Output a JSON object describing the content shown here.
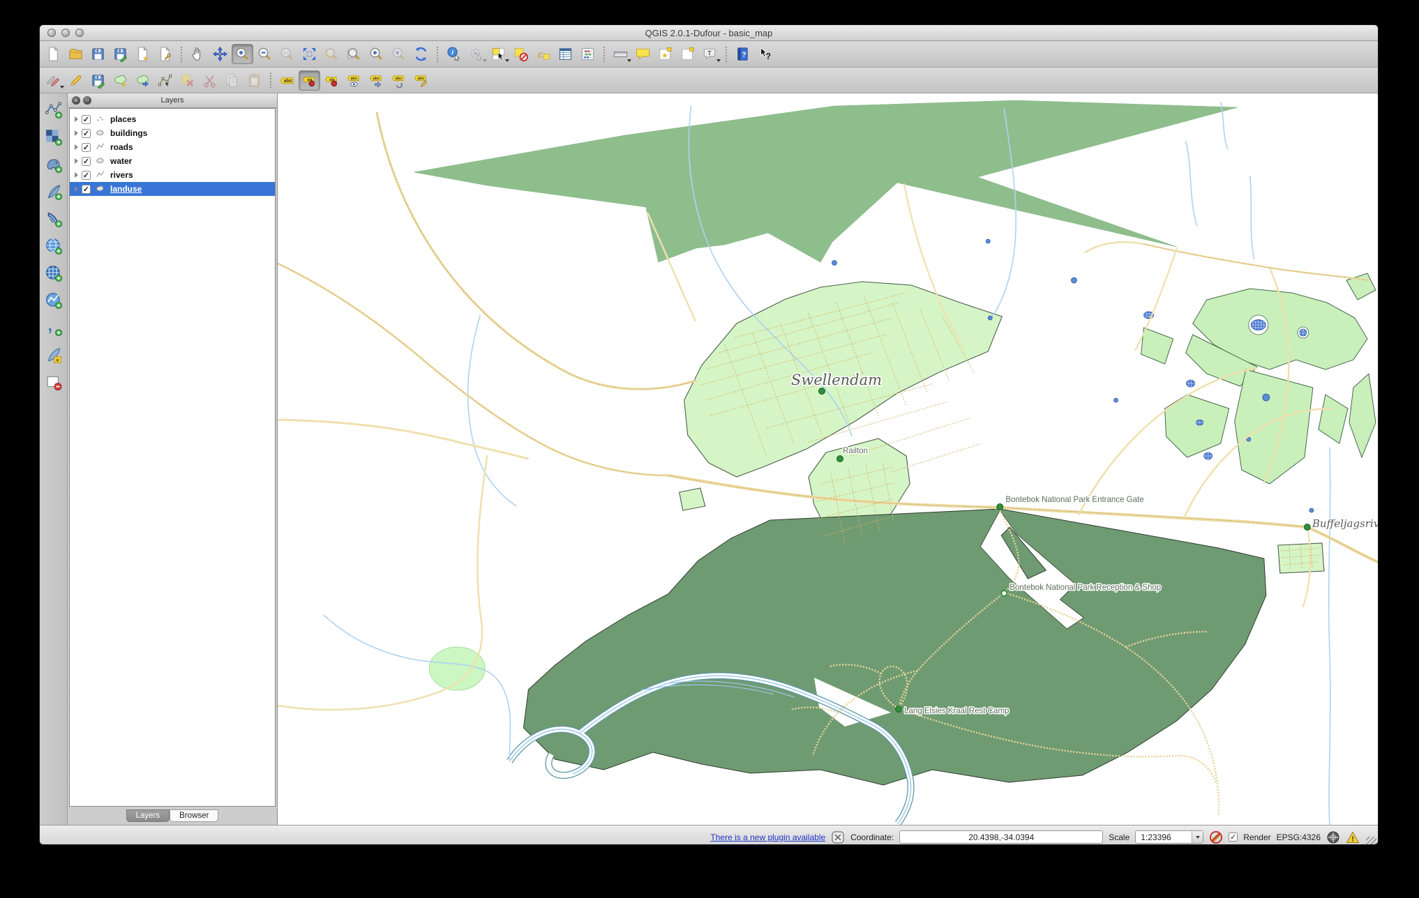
{
  "window": {
    "title": "QGIS 2.0.1-Dufour - basic_map"
  },
  "toolbars": {
    "row1": [
      {
        "name": "new-project",
        "icon": "pg"
      },
      {
        "name": "open-project",
        "icon": "fold"
      },
      {
        "name": "save-project",
        "icon": "flp"
      },
      {
        "name": "save-project-as",
        "icon": "flpe"
      },
      {
        "name": "new-print-composer",
        "icon": "pgs"
      },
      {
        "name": "composer-manager",
        "icon": "pgw"
      },
      {
        "sep": true
      },
      {
        "name": "pan-map",
        "icon": "hand"
      },
      {
        "name": "pan-to-selection",
        "icon": "mvx"
      },
      {
        "name": "zoom-in",
        "icon": "mgp",
        "state": "active"
      },
      {
        "name": "zoom-out",
        "icon": "mgm"
      },
      {
        "name": "zoom-actual-size",
        "icon": "mg11",
        "state": "disabled"
      },
      {
        "name": "zoom-full-extent",
        "icon": "mgf"
      },
      {
        "name": "zoom-to-selection",
        "icon": "mgsel",
        "state": "disabled"
      },
      {
        "name": "zoom-to-layer",
        "icon": "mglyr"
      },
      {
        "name": "zoom-last",
        "icon": "mglast"
      },
      {
        "name": "zoom-next",
        "icon": "mgnext",
        "state": "disabled"
      },
      {
        "name": "refresh-map",
        "icon": "refr"
      },
      {
        "sep": true
      },
      {
        "name": "identify-features",
        "icon": "idf"
      },
      {
        "name": "run-feature-action",
        "icon": "act",
        "caret": true,
        "state": "disabled"
      },
      {
        "name": "select-features",
        "icon": "sel",
        "caret": true
      },
      {
        "name": "deselect-features",
        "icon": "desel"
      },
      {
        "name": "select-by-expression",
        "icon": "expr"
      },
      {
        "name": "open-attribute-table",
        "icon": "tbl"
      },
      {
        "name": "field-calculator",
        "icon": "abac"
      },
      {
        "sep": true
      },
      {
        "name": "measure-line",
        "icon": "rul",
        "caret": true
      },
      {
        "name": "map-tips",
        "icon": "bub"
      },
      {
        "name": "new-bookmark",
        "icon": "bmn"
      },
      {
        "name": "show-bookmarks",
        "icon": "bm"
      },
      {
        "name": "text-annotation",
        "icon": "ann",
        "caret": true
      },
      {
        "sep": true
      },
      {
        "name": "help-contents",
        "icon": "hlp"
      },
      {
        "name": "whats-this",
        "icon": "wt"
      }
    ],
    "row2": [
      {
        "name": "current-edits",
        "icon": "pcls",
        "caret": true
      },
      {
        "name": "toggle-editing",
        "icon": "pcl"
      },
      {
        "name": "save-layer-edits",
        "icon": "flpe"
      },
      {
        "name": "add-feature",
        "icon": "blbs"
      },
      {
        "name": "move-feature",
        "icon": "blba"
      },
      {
        "name": "node-tool",
        "icon": "node"
      },
      {
        "name": "delete-selected",
        "icon": "del",
        "state": "disabled"
      },
      {
        "name": "cut-features",
        "icon": "scis",
        "state": "disabled"
      },
      {
        "name": "copy-features",
        "icon": "copy",
        "state": "disabled"
      },
      {
        "name": "paste-features",
        "icon": "pst",
        "state": "disabled"
      },
      {
        "sep": true
      },
      {
        "name": "layer-labeling-options",
        "icon": "labc"
      },
      {
        "name": "pin-unpin-labels",
        "icon": "lpin",
        "state": "active"
      },
      {
        "name": "highlight-pinned-labels",
        "icon": "lpin"
      },
      {
        "name": "show-hide-labels",
        "icon": "leye"
      },
      {
        "name": "move-label",
        "icon": "lmov"
      },
      {
        "name": "rotate-label",
        "icon": "lrot"
      },
      {
        "name": "change-label-properties",
        "icon": "ledt"
      }
    ],
    "left": [
      {
        "name": "add-vector-layer",
        "icon": "lvv"
      },
      {
        "name": "add-raster-layer",
        "icon": "lvr"
      },
      {
        "name": "add-postgis-layer",
        "icon": "lvpg"
      },
      {
        "name": "add-spatialite-layer",
        "icon": "lvsl"
      },
      {
        "name": "add-mssql-layer",
        "icon": "lvms"
      },
      {
        "name": "add-wms-layer",
        "icon": "lvwms"
      },
      {
        "name": "add-wcs-layer",
        "icon": "lvwcs"
      },
      {
        "name": "add-wfs-layer",
        "icon": "lvwfs"
      },
      {
        "name": "add-delimited-text-layer",
        "icon": "lvcsv"
      },
      {
        "name": "new-spatialite-layer",
        "icon": "lvsln"
      },
      {
        "name": "new-shapefile-layer",
        "icon": "lvshp"
      }
    ]
  },
  "layers_panel": {
    "title": "Layers",
    "layers": [
      {
        "label": "places",
        "geom": "point",
        "checked": true
      },
      {
        "label": "buildings",
        "geom": "polygon",
        "checked": true
      },
      {
        "label": "roads",
        "geom": "line",
        "checked": true
      },
      {
        "label": "water",
        "geom": "polygon",
        "checked": true
      },
      {
        "label": "rivers",
        "geom": "line",
        "checked": true
      },
      {
        "label": "landuse",
        "geom": "polygon",
        "checked": true,
        "selected": true
      }
    ],
    "tabs": [
      {
        "label": "Layers",
        "active": true
      },
      {
        "label": "Browser",
        "active": false
      }
    ]
  },
  "map": {
    "labels": {
      "swellendam": "Swellendam",
      "railton": "Railton",
      "entrance_gate": "Bontebok National Park Entrance Gate",
      "reception": "Bontebok National Park Reception & Shop",
      "rest_camp": "Lang Elsies Kraal Rest Camp",
      "buffeljagsrivier": "Buffeljagsrivier"
    }
  },
  "status_bar": {
    "plugin_link": "There is a new plugin available",
    "coordinate_label": "Coordinate:",
    "coordinate_value": "20.4398,-34.0394",
    "scale_label": "Scale",
    "scale_value": "1:23396",
    "render_label": "Render",
    "epsg_label": "EPSG:4326"
  },
  "colors": {
    "selection": "#3875d7",
    "forest": "#8fbe8d",
    "park": "#6f9b72",
    "urban": "#d6f5c6",
    "farmland": "#c9f0bb",
    "road": "#efe0ae",
    "road_dot": "#cfae62",
    "river": "#aed3f0",
    "water": "#5b8dd6"
  }
}
